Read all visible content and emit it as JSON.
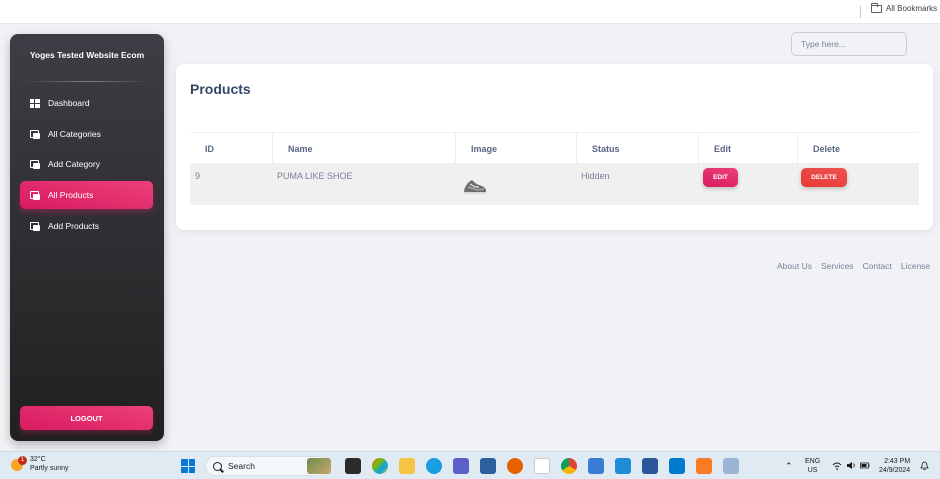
{
  "browser": {
    "bookmarks_label": "All Bookmarks"
  },
  "sidebar": {
    "brand": "Yoges Tested Website Ecom",
    "items": [
      {
        "label": "Dashboard",
        "icon": "dashboard-icon",
        "active": false
      },
      {
        "label": "All Categories",
        "icon": "list-icon",
        "active": false
      },
      {
        "label": "Add Category",
        "icon": "list-icon",
        "active": false
      },
      {
        "label": "All Products",
        "icon": "list-icon",
        "active": true
      },
      {
        "label": "Add Products",
        "icon": "list-icon",
        "active": false
      }
    ],
    "logout_label": "LOGOUT"
  },
  "search": {
    "placeholder": "Type here..."
  },
  "main": {
    "title": "Products",
    "table": {
      "columns": [
        "ID",
        "Name",
        "Image",
        "Status",
        "Edit",
        "Delete"
      ],
      "rows": [
        {
          "id": "9",
          "name": "PUMA LIKE SHOE",
          "image": "shoe-image",
          "status": "Hidden",
          "edit_label": "EDIT",
          "delete_label": "DELETE"
        }
      ]
    }
  },
  "footer": {
    "links": [
      "About Us",
      "Services",
      "Contact",
      "License"
    ]
  },
  "taskbar": {
    "weather_temp": "32°C",
    "weather_desc": "Partly sunny",
    "weather_badge": "1",
    "search_label": "Search",
    "lang_top": "ENG",
    "lang_bottom": "US",
    "time": "2:43 PM",
    "date": "24/9/2024"
  },
  "colors": {
    "accent": "#e91e63",
    "delete": "#f44335",
    "sidebar_bg": "#2d2d32",
    "page_bg": "#f0f2f5"
  }
}
